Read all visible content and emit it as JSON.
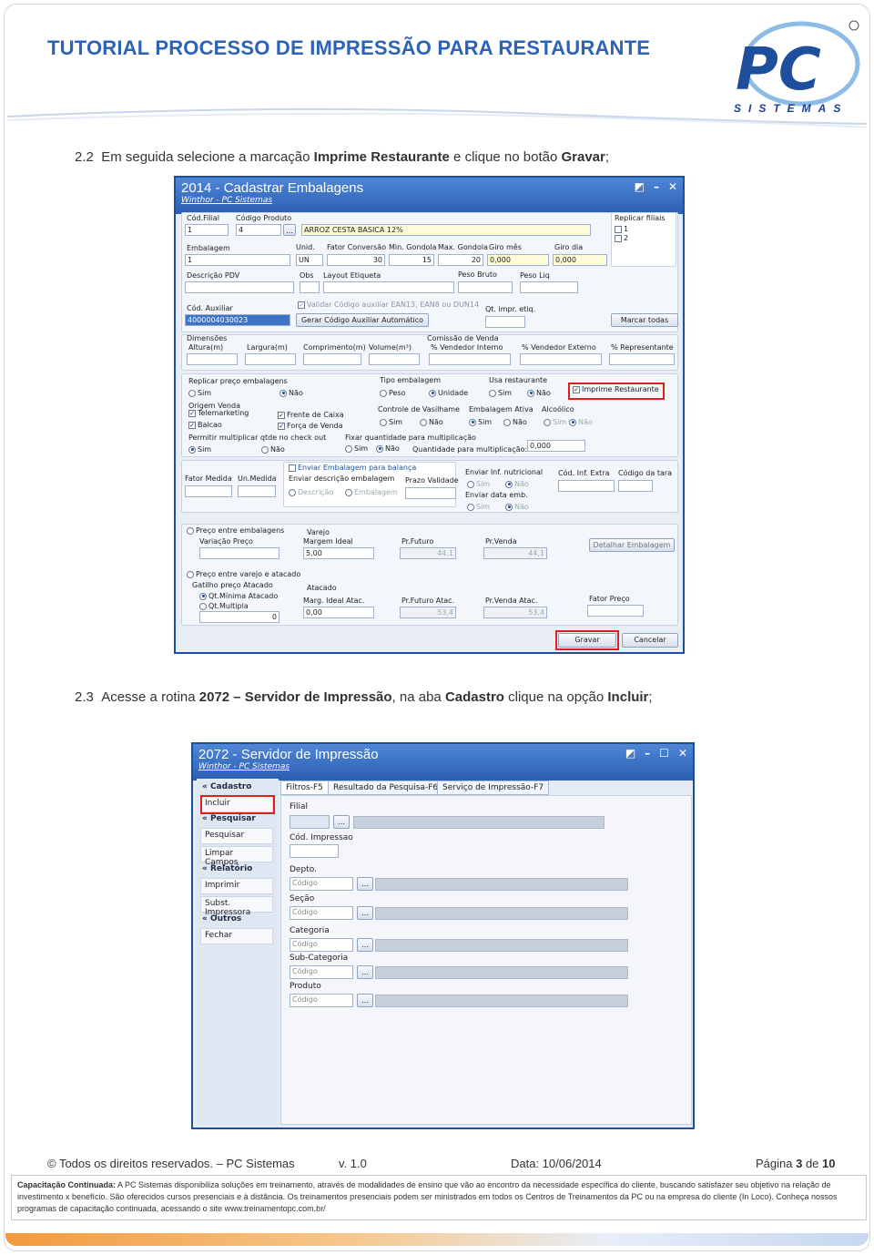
{
  "header": {
    "title": "TUTORIAL PROCESSO DE IMPRESSÃO PARA RESTAURANTE",
    "logo_letters": "PC",
    "logo_sub": "SISTEMAS"
  },
  "step1": {
    "num": "2.2",
    "pre": "Em seguida selecione a marcação ",
    "b1": "Imprime Restaurante",
    "mid": " e clique no botão ",
    "b2": "Gravar",
    "end": ";"
  },
  "step2": {
    "num": "2.3",
    "pre": "Acesse a rotina ",
    "b1": "2072 – Servidor de Impressão",
    "mid": ", na aba ",
    "b2": "Cadastro",
    "mid2": " clique na opção ",
    "b3": "Incluir",
    "end": ";"
  },
  "win1": {
    "title": "2014 - Cadastrar Embalagens",
    "subtitle": "Winthor - PC Sistemas",
    "cod_filial_label": "Cód.Filial",
    "cod_filial": "1",
    "cod_produto_label": "Código Produto",
    "cod_produto": "4",
    "produto_desc": "ARROZ CESTA BASICA 12%",
    "replicar_filiais": "Replicar filiais",
    "filial1": "1",
    "filial2": "2",
    "embalagem": "Embalagem",
    "embalagem_val": "1",
    "unid": "Unid.",
    "unid_val": "UN",
    "fator": "Fator Conversão",
    "fator_val": "30",
    "min_gondola": "Min. Gondola",
    "min_gondola_val": "15",
    "max_gondola": "Max. Gondola",
    "max_gondola_val": "20",
    "giro_mes": "Giro mês",
    "giro_mes_val": "0,000",
    "giro_dia": "Giro dia",
    "giro_dia_val": "0,000",
    "descricao_pdv": "Descrição PDV",
    "obs": "Obs",
    "layout_etiqueta": "Layout Etiqueta",
    "peso_bruto": "Peso Bruto",
    "peso_liq": "Peso Liq",
    "cod_auxiliar": "Cód. Auxiliar",
    "cod_auxiliar_val": "4000004030023",
    "validar": "Validar Código auxiliar EAN13, EAN8 ou DUN14",
    "gerar_codigo": "Gerar Código Auxiliar Automático",
    "qt_impr": "Qt. impr. etiq.",
    "marcar_todas": "Marcar todas",
    "dimensoes": "Dimensões",
    "altura": "Altura(m)",
    "largura": "Largura(m)",
    "comprimento": "Comprimento(m)",
    "volume": "Volume(m³)",
    "comissao_venda": "Comissão de Venda",
    "pct_interno": "% Vendedor Interno",
    "pct_externo": "% Vendedor Externo",
    "pct_repr": "% Representante",
    "replicar_preco": "Replicar preço embalagens",
    "sim": "Sim",
    "nao": "Não",
    "tipo_embalagem": "Tipo embalagem",
    "peso": "Peso",
    "unidade": "Unidade",
    "usa_restaurante": "Usa restaurante",
    "imprime_restaurante": "Imprime Restaurante",
    "origem_venda": "Origem Venda",
    "telemarketing": "Telemarketing",
    "frente_caixa": "Frente de Caixa",
    "balcao": "Balcao",
    "forca_venda": "Força de Venda",
    "controle_vasilhame": "Controle de Vasilhame",
    "embalagem_ativa": "Embalagem Ativa",
    "alcoolico": "Alcoólico",
    "permitir_multiplicar": "Permitir multiplicar qtde no check out",
    "fixar_qtd": "Fixar quantidade para multiplicação",
    "qtd_mult": "Quantidade para multiplicação:",
    "qtd_mult_val": "0,000",
    "fator_medida": "Fator Medida",
    "un_medida": "Un.Medida",
    "enviar_balanca": "Enviar Embalagem para balança",
    "enviar_descricao": "Enviar descrição embalagem",
    "descricao": "Descrição",
    "embalagem_opt": "Embalagem",
    "prazo_validade": "Prazo Validade",
    "enviar_nutricional": "Enviar Inf. nutricional",
    "enviar_data": "Enviar data emb.",
    "cod_inf_extra": "Cód. Inf. Extra",
    "cod_tara": "Código da tara",
    "preco_entre": "Preço entre embalagens",
    "variacao_preco": "Variação Preço",
    "varejo": "Varejo",
    "margem_ideal": "Margem Ideal",
    "margem_val": "5,00",
    "pr_futuro": "Pr.Futuro",
    "pr_futuro_val": "44,1",
    "pr_venda": "Pr.Venda",
    "pr_venda_val": "44,1",
    "detalhar": "Detalhar Embalagem",
    "preco_varejo_atacado": "Preço entre varejo e atacado",
    "gatilho": "Gatilho preço Atacado",
    "qt_minima": "Qt.Mínima Atacado",
    "qt_multipla": "Qt.Multipla",
    "qt_val": "0",
    "atacado": "Atacado",
    "marg_ideal_atac": "Marg. Ideal Atac.",
    "marg_ideal_atac_val": "0,00",
    "pr_futuro_atac": "Pr.Futuro Atac.",
    "pr_futuro_atac_val": "53,4",
    "pr_venda_atac": "Pr.Venda Atac.",
    "pr_venda_atac_val": "53,4",
    "fator_preco": "Fator Preço",
    "gravar": "Gravar",
    "cancelar": "Cancelar"
  },
  "win2": {
    "title": "2072 - Servidor de Impressão",
    "subtitle": "Winthor - PC Sistemas",
    "sidebar": {
      "cadastro": "Cadastro",
      "incluir": "Incluir",
      "pesquisar_head": "Pesquisar",
      "pesquisar": "Pesquisar",
      "limpar": "Limpar Campos",
      "relatorio": "Relatório",
      "imprimir": "Imprimir",
      "subst": "Subst. Impressora",
      "outros": "Outros",
      "fechar": "Fechar"
    },
    "tabs": [
      "Filtros-F5",
      "Resultado da Pesquisa-F6",
      "Serviço de Impressão-F7"
    ],
    "filial": "Filial",
    "cod_impressao": "Cód. Impressao",
    "depto": "Depto.",
    "secao": "Seção",
    "categoria": "Categoria",
    "subcategoria": "Sub-Categoria",
    "produto": "Produto",
    "codigo": "Código",
    "dots": "..."
  },
  "footer": {
    "rights": "© Todos os direitos reservados. – PC Sistemas",
    "version": "v. 1.0",
    "date": "Data: 10/06/2014",
    "page_pre": "Página ",
    "page_num": "3",
    "page_mid": " de ",
    "page_total": "10",
    "box_bold": "Capacitação Continuada:",
    "box_text": " A PC Sistemas disponibiliza soluções em treinamento, através de modalidades de ensino que vão ao encontro da necessidade específica do cliente, buscando satisfazer seu objetivo na relação de investimento x benefício. São oferecidos cursos presenciais e à distância. Os treinamentos presenciais podem ser ministrados em todos os Centros de Treinamentos da PC ou na empresa do cliente (In Loco). Conheça nossos programas de capacitação continuada, acessando o site www.treinamentopc.com.br/"
  }
}
